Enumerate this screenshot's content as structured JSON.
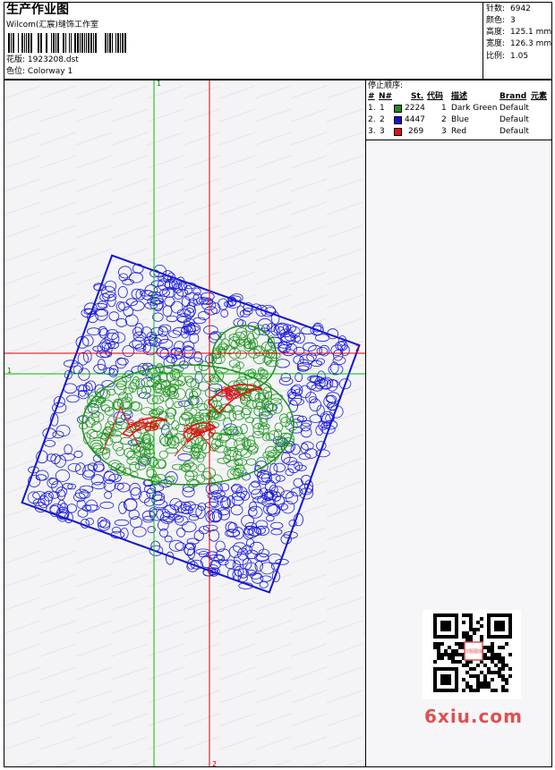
{
  "header": {
    "title": "生产作业图",
    "studio": "Wilcom(汇宸)缝饰工作室",
    "design_label": "花版:",
    "design_file": "1923208.dst",
    "colorway_label": "色位:",
    "colorway_name": "Colorway 1"
  },
  "stats": [
    {
      "label": "针数:",
      "value": "6942"
    },
    {
      "label": "颜色:",
      "value": "3"
    },
    {
      "label": "高度:",
      "value": "125.1 mm"
    },
    {
      "label": "宽度:",
      "value": "126.3 mm"
    },
    {
      "label": "比例:",
      "value": "1.05"
    }
  ],
  "stop_sequence": {
    "title": "停止顺序:",
    "columns": [
      "#",
      "N#",
      "St.",
      "代码",
      "描述",
      "Brand",
      "元素"
    ],
    "rows": [
      {
        "num": "1.",
        "n": "1",
        "stitches": "2224",
        "code": "1",
        "description": "Dark Green",
        "brand": "Default",
        "color": "#1e8c1e"
      },
      {
        "num": "2.",
        "n": "2",
        "stitches": "4447",
        "code": "2",
        "description": "Blue",
        "brand": "Default",
        "color": "#1414d2"
      },
      {
        "num": "3.",
        "n": "3",
        "stitches": "269",
        "code": "3",
        "description": "Red",
        "brand": "Default",
        "color": "#e01414"
      }
    ]
  },
  "guides": {
    "green_label": "1",
    "red_label": "2"
  },
  "watermark": "6xiu.com",
  "qr_stamp": "汉服图库"
}
